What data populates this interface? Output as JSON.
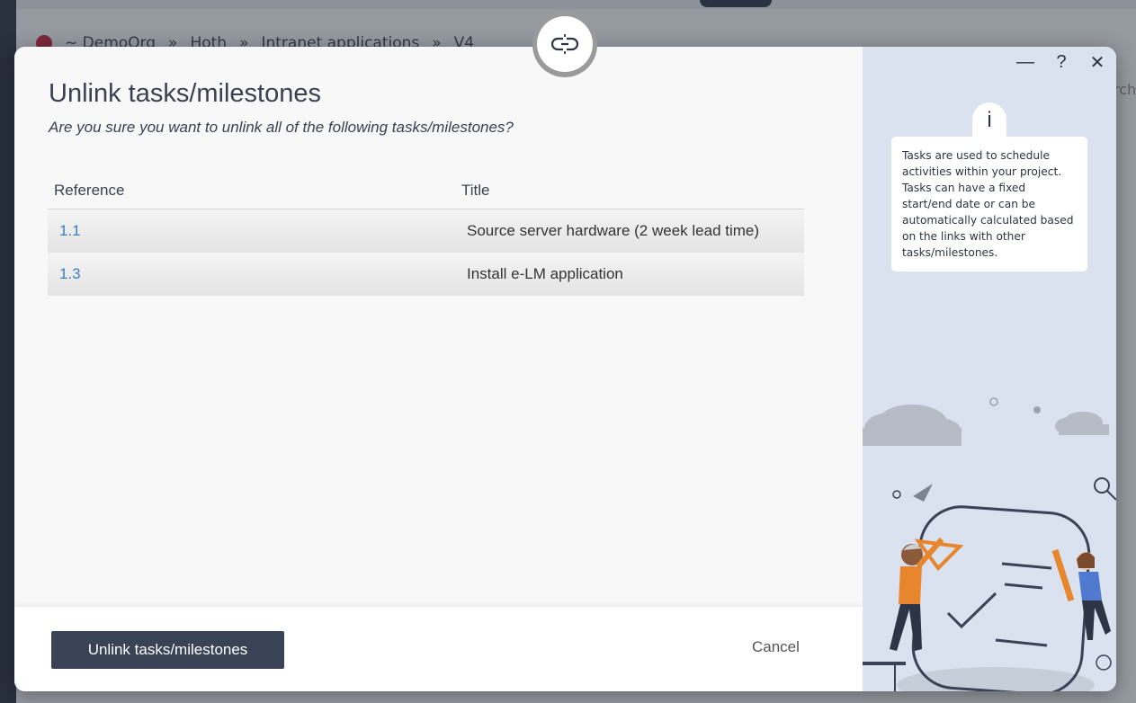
{
  "background": {
    "breadcrumb": [
      "~ DemoOrg",
      "»",
      "Hoth",
      "»",
      "Intranet applications",
      "»",
      "V4"
    ],
    "search_hint": "rch"
  },
  "dialog": {
    "title": "Unlink tasks/milestones",
    "subtitle": "Are you sure you want to unlink all of the following tasks/milestones?",
    "table": {
      "columns": [
        "Reference",
        "Title"
      ],
      "rows": [
        {
          "reference": "1.1",
          "title": "Source server hardware (2 week lead time)"
        },
        {
          "reference": "1.3",
          "title": "Install e-LM application"
        }
      ]
    },
    "primary_button": "Unlink tasks/milestones",
    "cancel_button": "Cancel"
  },
  "side": {
    "info_icon": "i",
    "info_text": "Tasks are used to schedule activities within your project. Tasks can have a fixed start/end date or can be automatically calculated based on the links with other tasks/milestones.",
    "controls": {
      "minimize": "—",
      "help": "?",
      "close": "✕"
    }
  },
  "colors": {
    "primary": "#3a4256",
    "link": "#3b7dc8",
    "side_bg": "#d9e2ee",
    "accent_orange": "#e8862e"
  },
  "icons": {
    "link_badge": "unlink-icon",
    "info": "info-icon"
  }
}
